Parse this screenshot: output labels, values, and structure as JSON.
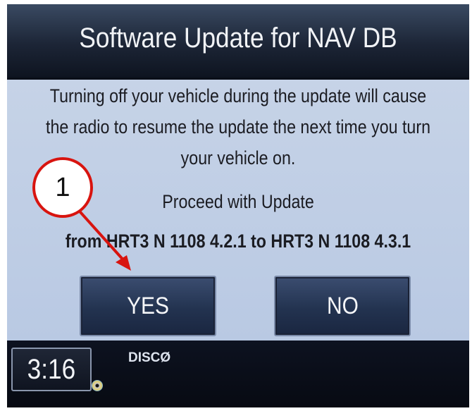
{
  "dialog": {
    "title": "Software Update for NAV DB",
    "message_lines": [
      "Turning off your vehicle during the update will cause",
      "the radio to resume the update the next time you turn",
      "your vehicle on."
    ],
    "prompt": "Proceed with Update",
    "version_line": "from HRT3 N 1108 4.2.1 to HRT3 N 1108 4.3.1",
    "yes_label": "YES",
    "no_label": "NO"
  },
  "status_bar": {
    "clock": "3:16",
    "source": "DISCØ",
    "disc_icon": "disc-icon"
  },
  "annotation": {
    "callout_number": "1",
    "color": "#d8140f"
  },
  "colors": {
    "panel": "#bccbe4",
    "button": "#2a3a5c",
    "title_bar": "#1c2536"
  }
}
